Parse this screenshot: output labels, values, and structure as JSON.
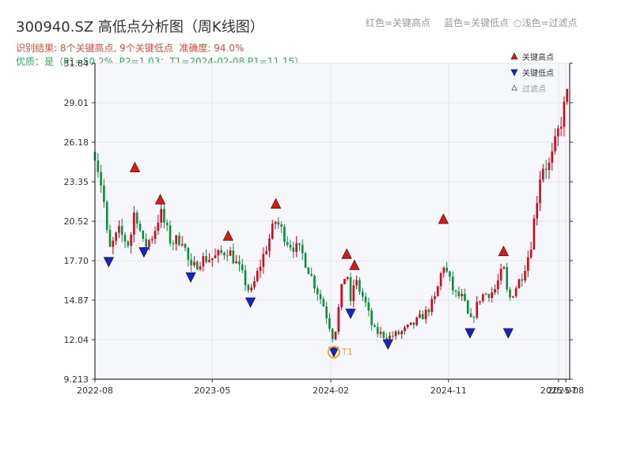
{
  "header": {
    "title": "300940.SZ 高低点分析图（周K线图）",
    "note_result": "识别结果: 8个关键高点, 9个关键低点",
    "note_accuracy": "准确度: 94.0%",
    "note_quality": "优质：是（P1=50.2%, P2=1.03；T1=2024-02-08 P1=11.15）",
    "hint_red": "红色=关键高点",
    "hint_blue": "蓝色=关键低点",
    "hint_hollow": "○浅色=过滤点"
  },
  "colors": {
    "up": "#e2001a",
    "down": "#0a8f3a",
    "high_marker": "#ee1111",
    "low_marker": "#1122dd",
    "t1_ring": "#f5a623",
    "plot_bg": "#f5f7fa",
    "grid": "#e3e6ea"
  },
  "chart_data": {
    "type": "candlestick",
    "ylim": [
      9.213,
      31.84
    ],
    "yticks": [
      "9.213",
      "12.04",
      "14.87",
      "17.70",
      "20.52",
      "23.35",
      "26.18",
      "29.01",
      "31.84"
    ],
    "xlim": [
      "2022-08-01",
      "2025-08-10"
    ],
    "xticks": [
      {
        "date": "2022-08-01",
        "label": "2022-08"
      },
      {
        "date": "2023-05-01",
        "label": "2023-05"
      },
      {
        "date": "2024-02-01",
        "label": "2024-02"
      },
      {
        "date": "2024-11-01",
        "label": "2024-11"
      },
      {
        "date": "2025-07-15",
        "label": "2025-07"
      },
      {
        "date": "2025-08-01",
        "label": "2025-08"
      }
    ],
    "key_highs": [
      {
        "date": "2022-11-02",
        "price": 24.0
      },
      {
        "date": "2022-12-31",
        "price": 21.7
      },
      {
        "date": "2023-06-07",
        "price": 19.1
      },
      {
        "date": "2023-09-26",
        "price": 21.4
      },
      {
        "date": "2024-03-09",
        "price": 17.8
      },
      {
        "date": "2024-03-27",
        "price": 17.0
      },
      {
        "date": "2024-10-20",
        "price": 20.3
      },
      {
        "date": "2025-03-09",
        "price": 18.0
      }
    ],
    "key_lows": [
      {
        "date": "2022-09-02",
        "price": 17.6
      },
      {
        "date": "2022-11-23",
        "price": 18.3
      },
      {
        "date": "2023-03-12",
        "price": 16.5
      },
      {
        "date": "2023-07-29",
        "price": 14.7
      },
      {
        "date": "2024-02-08",
        "price": 11.15
      },
      {
        "date": "2024-03-18",
        "price": 13.9
      },
      {
        "date": "2024-06-13",
        "price": 11.7
      },
      {
        "date": "2024-12-21",
        "price": 12.5
      },
      {
        "date": "2025-03-20",
        "price": 12.5
      }
    ],
    "t1": {
      "date": "2024-02-08",
      "price": 11.15,
      "label": "T1"
    },
    "legend": [
      {
        "label": "关键高点",
        "marker": "red-up-triangle"
      },
      {
        "label": "关键低点",
        "marker": "blue-down-triangle"
      },
      {
        "label": "过滤点",
        "marker": "hollow-triangle"
      }
    ],
    "legend_position": "top-right",
    "grid": true,
    "anchors": [
      [
        "2022-08-01",
        25.5
      ],
      [
        "2022-08-20",
        22.5
      ],
      [
        "2022-09-02",
        18.3
      ],
      [
        "2022-09-25",
        19.8
      ],
      [
        "2022-10-20",
        18.8
      ],
      [
        "2022-11-02",
        21.5
      ],
      [
        "2022-11-23",
        18.6
      ],
      [
        "2022-12-15",
        19.6
      ],
      [
        "2022-12-31",
        21.2
      ],
      [
        "2023-01-25",
        19.0
      ],
      [
        "2023-02-20",
        19.3
      ],
      [
        "2023-03-12",
        17.0
      ],
      [
        "2023-04-05",
        17.8
      ],
      [
        "2023-05-05",
        17.9
      ],
      [
        "2023-06-07",
        18.5
      ],
      [
        "2023-07-05",
        17.0
      ],
      [
        "2023-07-29",
        15.3
      ],
      [
        "2023-08-25",
        17.8
      ],
      [
        "2023-09-26",
        20.6
      ],
      [
        "2023-10-25",
        19.0
      ],
      [
        "2023-11-25",
        18.3
      ],
      [
        "2023-12-25",
        16.0
      ],
      [
        "2024-01-15",
        14.5
      ],
      [
        "2024-02-08",
        12.0
      ],
      [
        "2024-02-25",
        15.5
      ],
      [
        "2024-03-09",
        17.2
      ],
      [
        "2024-03-18",
        14.5
      ],
      [
        "2024-03-27",
        16.4
      ],
      [
        "2024-04-20",
        14.8
      ],
      [
        "2024-05-10",
        12.7
      ],
      [
        "2024-06-13",
        12.2
      ],
      [
        "2024-07-10",
        12.5
      ],
      [
        "2024-08-10",
        13.1
      ],
      [
        "2024-09-10",
        14.0
      ],
      [
        "2024-10-01",
        15.0
      ],
      [
        "2024-10-20",
        17.5
      ],
      [
        "2024-11-15",
        15.3
      ],
      [
        "2024-12-05",
        15.0
      ],
      [
        "2024-12-21",
        13.2
      ],
      [
        "2025-01-15",
        15.2
      ],
      [
        "2025-02-15",
        15.5
      ],
      [
        "2025-03-09",
        17.2
      ],
      [
        "2025-03-20",
        14.8
      ],
      [
        "2025-04-20",
        16.6
      ],
      [
        "2025-05-10",
        18.5
      ],
      [
        "2025-06-05",
        24.5
      ],
      [
        "2025-06-25",
        24.5
      ],
      [
        "2025-07-15",
        27.0
      ],
      [
        "2025-08-08",
        30.0
      ]
    ]
  }
}
